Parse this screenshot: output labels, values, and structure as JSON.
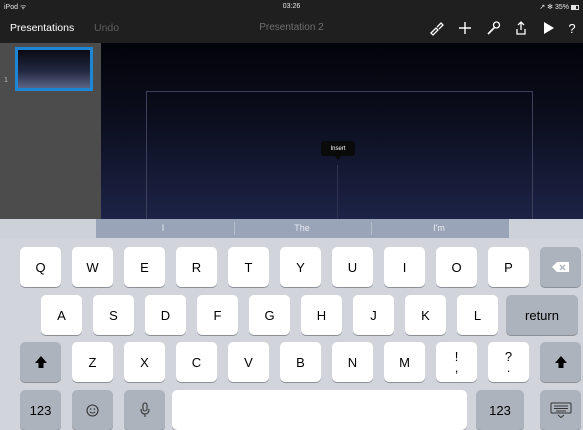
{
  "status_bar": {
    "left": "iPod ᯤ",
    "time": "03:26",
    "right": "↗ ✻ 35%"
  },
  "toolbar": {
    "presentations_label": "Presentations",
    "undo_label": "Undo",
    "title": "Presentation 2"
  },
  "navigator": {
    "slide_number": "1"
  },
  "canvas": {
    "popup_label": "Insert"
  },
  "predictive": {
    "suggestions": [
      "I",
      "The",
      "I'm"
    ]
  },
  "keyboard": {
    "row1": [
      "Q",
      "W",
      "E",
      "R",
      "T",
      "Y",
      "U",
      "I",
      "O",
      "P"
    ],
    "row2": [
      "A",
      "S",
      "D",
      "F",
      "G",
      "H",
      "J",
      "K",
      "L"
    ],
    "row3": [
      "Z",
      "X",
      "C",
      "V",
      "B",
      "N",
      "M"
    ],
    "return_label": "return",
    "numbers_label": "123",
    "exclaim_top": "!",
    "exclaim_bottom": ",",
    "question_top": "?",
    "question_bottom": "."
  },
  "colors": {
    "toolbar_bg": "#1f1f1f",
    "selection_blue": "#1d87d6",
    "keyboard_bg": "#d1d5db"
  }
}
